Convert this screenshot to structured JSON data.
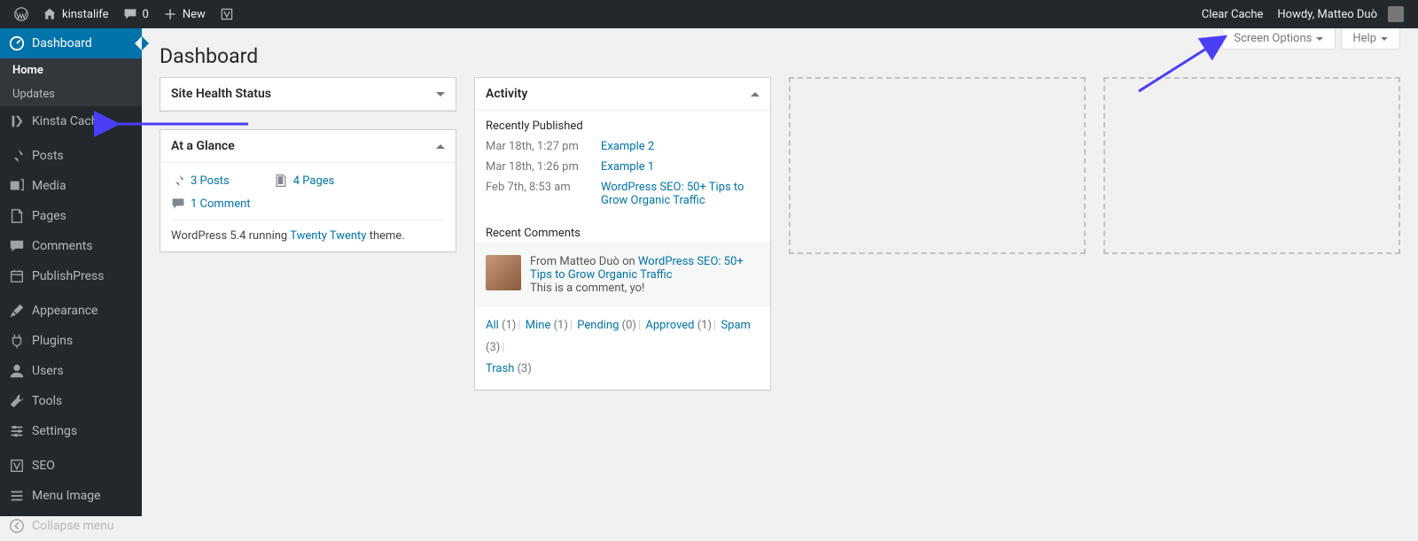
{
  "toolbar": {
    "site_name": "kinstalife",
    "comments_count": "0",
    "new_label": "New",
    "clear_cache": "Clear Cache",
    "howdy": "Howdy, Matteo Duò"
  },
  "sidebar": {
    "dashboard": "Dashboard",
    "home": "Home",
    "updates": "Updates",
    "kinsta_cache": "Kinsta Cache",
    "posts": "Posts",
    "media": "Media",
    "pages": "Pages",
    "comments": "Comments",
    "publishpress": "PublishPress",
    "appearance": "Appearance",
    "plugins": "Plugins",
    "users": "Users",
    "tools": "Tools",
    "settings": "Settings",
    "seo": "SEO",
    "menu_image": "Menu Image",
    "collapse": "Collapse menu"
  },
  "screen_meta": {
    "screen_options": "Screen Options",
    "help": "Help"
  },
  "page_title": "Dashboard",
  "widgets": {
    "site_health": {
      "title": "Site Health Status"
    },
    "glance": {
      "title": "At a Glance",
      "posts": "3 Posts",
      "pages": "4 Pages",
      "comments": "1 Comment",
      "version_prefix": "WordPress 5.4 running ",
      "theme": "Twenty Twenty",
      "version_suffix": " theme."
    },
    "activity": {
      "title": "Activity",
      "recently_published": "Recently Published",
      "posts": [
        {
          "date": "Mar 18th, 1:27 pm",
          "title": "Example 2"
        },
        {
          "date": "Mar 18th, 1:26 pm",
          "title": "Example 1"
        },
        {
          "date": "Feb 7th, 8:53 am",
          "title": "WordPress SEO: 50+ Tips to Grow Organic Traffic"
        }
      ],
      "recent_comments": "Recent Comments",
      "comment": {
        "from": "From Matteo Duò on ",
        "post": "WordPress SEO: 50+ Tips to Grow Organic Traffic",
        "body": "This is a comment, yo!"
      },
      "filters": {
        "all": "All",
        "all_c": " (1)",
        "mine": "Mine",
        "mine_c": " (1)",
        "pending": "Pending",
        "pending_c": " (0)",
        "approved": "Approved",
        "approved_c": " (1)",
        "spam": "Spam",
        "spam_c": " (3)",
        "trash": "Trash",
        "trash_c": " (3)"
      }
    }
  }
}
